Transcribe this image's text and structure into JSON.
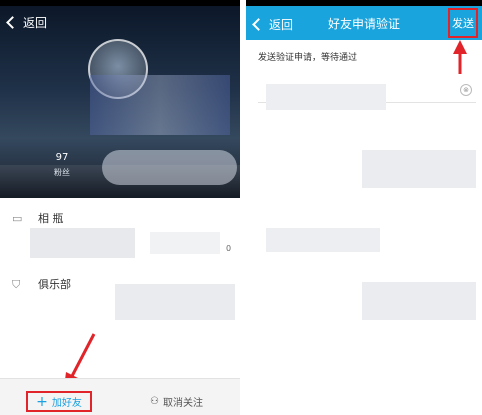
{
  "left": {
    "back_label": "返回",
    "fans_count": "97",
    "fans_label": "粉丝",
    "rows": [
      {
        "label": "相 瓶",
        "icon": "video-icon"
      },
      {
        "label": "俱乐部",
        "icon": "shield-icon"
      }
    ],
    "row_count_value": "0",
    "add_friend_label": "加好友",
    "unfollow_label": "取消关注"
  },
  "right": {
    "back_label": "返回",
    "title": "好友申请验证",
    "send_label": "发送",
    "hint": "发送验证申请，等待通过",
    "clear_icon": "⊗"
  },
  "colors": {
    "accent": "#19a4dd",
    "highlight": "#e0242a"
  }
}
